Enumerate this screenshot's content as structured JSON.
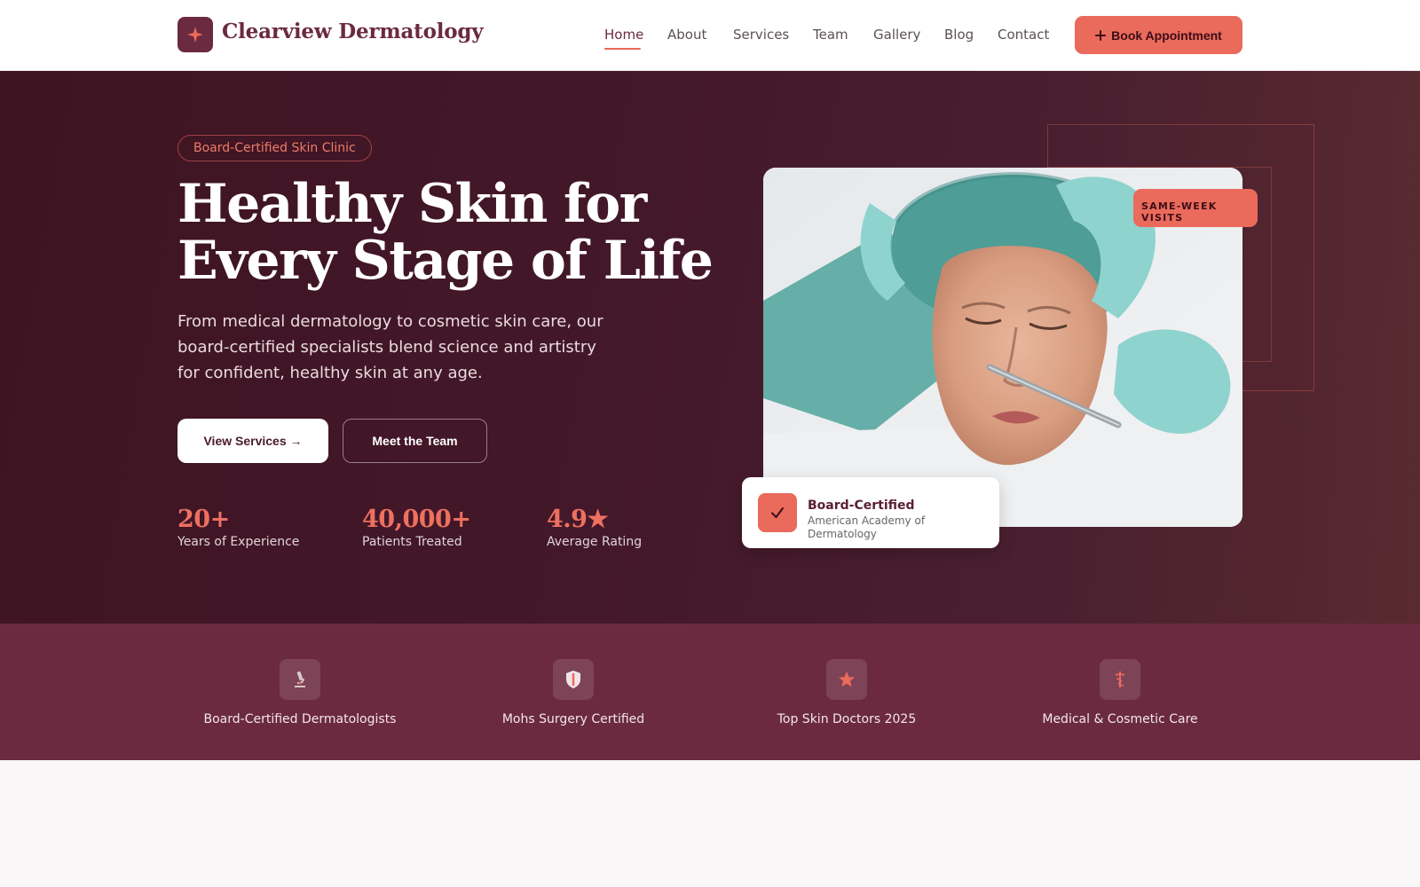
{
  "brand": {
    "name": "Clearview Dermatology",
    "logo_icon": "sparkle-icon"
  },
  "nav": {
    "items": [
      {
        "label": "Home",
        "active": true
      },
      {
        "label": "About"
      },
      {
        "label": "Services"
      },
      {
        "label": "Team"
      },
      {
        "label": "Gallery"
      },
      {
        "label": "Blog"
      },
      {
        "label": "Contact"
      }
    ],
    "cta_label": "Book Appointment",
    "cta_icon": "plus-icon"
  },
  "hero": {
    "badge": "Board-Certified Skin Clinic",
    "title_line1": "Healthy Skin for",
    "title_line2": "Every Stage of Life",
    "subtitle": "From medical dermatology to cosmetic skin care, our board-certified specialists blend science and artistry for confident, healthy skin at any age.",
    "primary_button": "View Services →",
    "secondary_button": "Meet the Team",
    "stats": [
      {
        "value": "20+",
        "label": "Years of Experience"
      },
      {
        "value": "40,000+",
        "label": "Patients Treated"
      },
      {
        "value": "4.9★",
        "label": "Average Rating"
      }
    ],
    "tag_line1": "SAME-WEEK",
    "tag_line2": "VISITS",
    "card": {
      "title": "Board-Certified",
      "subtitle": "American Academy of Dermatology",
      "icon": "check-icon"
    }
  },
  "trust": [
    {
      "icon": "microscope-icon",
      "label": "Board-Certified Dermatologists"
    },
    {
      "icon": "shield-icon",
      "label": "Mohs Surgery Certified"
    },
    {
      "icon": "star-icon",
      "label": "Top Skin Doctors 2025"
    },
    {
      "icon": "caduceus-icon",
      "label": "Medical & Cosmetic Care"
    }
  ],
  "colors": {
    "brand": "#6b2a40",
    "accent": "#ea6a5b",
    "hero_bg": "#3e1422",
    "trust_bg": "#6b2a40"
  }
}
